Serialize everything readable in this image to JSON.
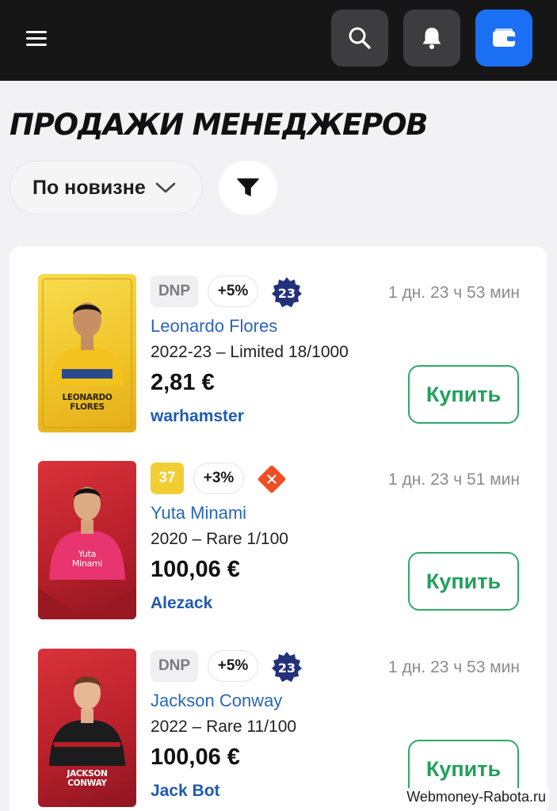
{
  "header": {
    "menu_icon": "hamburger-menu-icon",
    "buttons": [
      {
        "icon": "search-icon"
      },
      {
        "icon": "bell-icon"
      },
      {
        "icon": "wallet-icon",
        "color": "#1b6ff2"
      }
    ]
  },
  "page": {
    "title": "ПРОДАЖИ МЕНЕДЖЕРОВ"
  },
  "controls": {
    "sort_label": "По новизне",
    "sort_icon": "chevron-down-icon",
    "filter_icon": "filter-funnel-icon"
  },
  "listings": [
    {
      "badge": "DNP",
      "bonus": "+5%",
      "rank": "23",
      "time_left": "1 дн. 23 ч 53 мин",
      "player": "Leonardo Flores",
      "edition": "2022-23 – Limited 18/1000",
      "price": "2,81 €",
      "seller": "warhamster",
      "buy_label": "Купить",
      "card_name_line1": "LEONARDO",
      "card_name_line2": "FLORES",
      "card_color": "#f0c52a"
    },
    {
      "badge": "37",
      "bonus": "+3%",
      "rank_icon": "red-diamond-x-icon",
      "time_left": "1 дн. 23 ч 51 мин",
      "player": "Yuta Minami",
      "edition": "2020 – Rare 1/100",
      "price": "100,06 €",
      "seller": "Alezack",
      "buy_label": "Купить",
      "card_name_line1": "Yuta",
      "card_name_line2": "Minami",
      "card_color": "#c2232c"
    },
    {
      "badge": "DNP",
      "bonus": "+5%",
      "rank": "23",
      "time_left": "1 дн. 23 ч 53 мин",
      "player": "Jackson Conway",
      "edition": "2022 – Rare 11/100",
      "price": "100,06 €",
      "seller": "Jack Bot",
      "buy_label": "Купить",
      "card_name_line1": "JACKSON",
      "card_name_line2": "CONWAY",
      "card_color": "#c2232c"
    }
  ],
  "watermark": "Webmoney-Rabota.ru"
}
